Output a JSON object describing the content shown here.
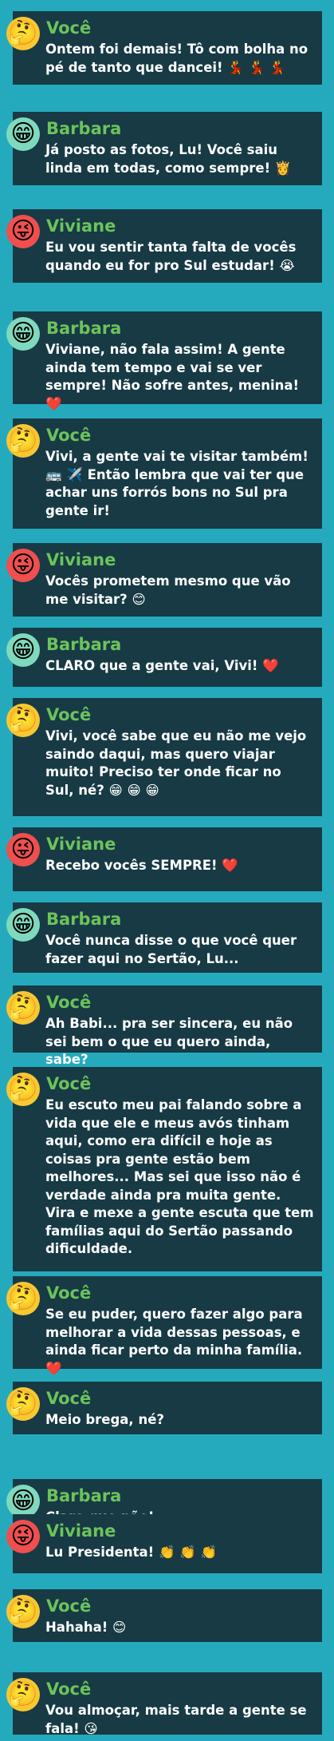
{
  "colors": {
    "background": "#25aabd",
    "bubble": "#173a45",
    "name": "#6cc35b",
    "text": "#ffffff"
  },
  "participants": {
    "voce": {
      "icon": "thinking-face-icon",
      "glyph": "🤔",
      "avatar_color": "#f7c833"
    },
    "barbara": {
      "icon": "grinning-face-icon",
      "glyph": "😁",
      "avatar_color": "#7fd9bd"
    },
    "viviane": {
      "icon": "tongue-wink-face-icon",
      "glyph": "😜",
      "avatar_color": "#ef4f4f"
    }
  },
  "messages": [
    {
      "who": "voce",
      "sender": "Você",
      "text": "Ontem foi demais! Tô com bolha no pé de tanto que dancei! 💃 💃 💃"
    },
    {
      "who": "barbara",
      "sender": "Barbara",
      "text": "Já posto as fotos, Lu! Você saiu linda em todas, como sempre! 👸"
    },
    {
      "who": "viviane",
      "sender": "Viviane",
      "text": "Eu vou sentir tanta falta de vocês quando eu for pro Sul estudar! 😭"
    },
    {
      "who": "barbara",
      "sender": "Barbara",
      "text": "Viviane, não fala assim! A gente ainda tem tempo e vai se ver sempre! Não sofre antes, menina! ❤️"
    },
    {
      "who": "voce",
      "sender": "Você",
      "text": "Vivi, a gente vai te visitar também! 🚌 ✈️ Então lembra que vai ter que achar uns forrós bons no Sul pra gente ir!"
    },
    {
      "who": "viviane",
      "sender": "Viviane",
      "text": "Vocês prometem mesmo que vão me visitar? 😊"
    },
    {
      "who": "barbara",
      "sender": "Barbara",
      "text": "CLARO que a gente vai, Vivi! ❤️"
    },
    {
      "who": "voce",
      "sender": "Você",
      "text": "Vivi, você sabe que eu não me vejo saindo daqui, mas quero viajar muito! Preciso ter onde ficar no Sul, né? 😁 😁 😁"
    },
    {
      "who": "viviane",
      "sender": "Viviane",
      "text": "Recebo vocês SEMPRE! ❤️"
    },
    {
      "who": "barbara",
      "sender": "Barbara",
      "text": "Você nunca disse o que você quer fazer aqui no Sertão, Lu..."
    },
    {
      "who": "voce",
      "sender": "Você",
      "text": "Ah Babi... pra ser sincera, eu não sei bem o que eu quero ainda, sabe?"
    },
    {
      "who": "voce",
      "sender": "Você",
      "text": "Eu escuto meu pai falando sobre a vida que ele e meus avós tinham aqui, como era difícil e hoje as coisas pra gente estão bem melhores... Mas sei que isso não é verdade ainda pra muita gente. Vira e mexe a gente escuta que tem famílias aqui do Sertão passando dificuldade."
    },
    {
      "who": "voce",
      "sender": "Você",
      "text": "Se eu puder, quero fazer algo para melhorar a vida dessas pessoas, e ainda ficar perto da minha família.❤️"
    },
    {
      "who": "voce",
      "sender": "Você",
      "text": "Meio brega, né?"
    },
    {
      "who": "barbara",
      "sender": "Barbara",
      "text": "Claro que não!"
    },
    {
      "who": "viviane",
      "sender": "Viviane",
      "text": "Lu Presidenta! 👏 👏 👏"
    },
    {
      "who": "voce",
      "sender": "Você",
      "text": "Hahaha! 😊"
    },
    {
      "who": "voce",
      "sender": "Você",
      "text": "Vou almoçar, mais tarde a gente se fala! 😘"
    }
  ]
}
